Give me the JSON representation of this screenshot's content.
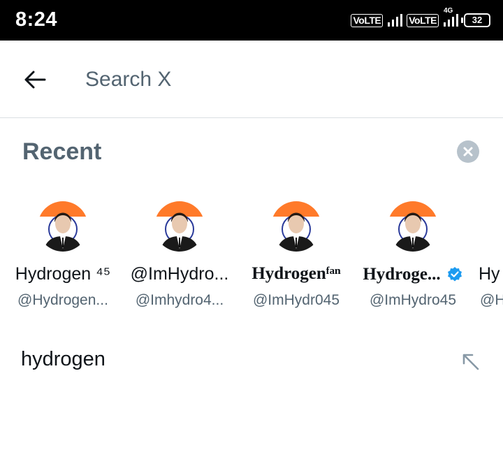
{
  "status_bar": {
    "time": "8:24",
    "volte_1": "VoLTE",
    "volte_2": "VoLTE",
    "network_tag": "4G",
    "battery": "32"
  },
  "search": {
    "placeholder": "Search X"
  },
  "recent": {
    "title": "Recent",
    "accounts": [
      {
        "name": "Hydrogen ⁴⁵",
        "handle": "@Hydrogen...",
        "avatar": "portrait-avatar"
      },
      {
        "name": "@ImHydro...",
        "handle": "@Imhydro4...",
        "avatar": "portrait-avatar"
      },
      {
        "name": "Hydrogenᶠᵃⁿ",
        "handle": "@ImHydr045",
        "avatar": "portrait-avatar"
      },
      {
        "name": "Hydroge...",
        "handle": "@ImHydro45",
        "avatar": "portrait-avatar",
        "verified": true
      },
      {
        "name": "Hy",
        "handle": "@H"
      }
    ],
    "queries": [
      {
        "text": "hydrogen"
      }
    ]
  },
  "colors": {
    "accent_blue": "#1d9bf0",
    "secondary_text": "#536471",
    "flag_saffron": "#ff7a2a",
    "flag_chakra": "#2a3a9a"
  }
}
